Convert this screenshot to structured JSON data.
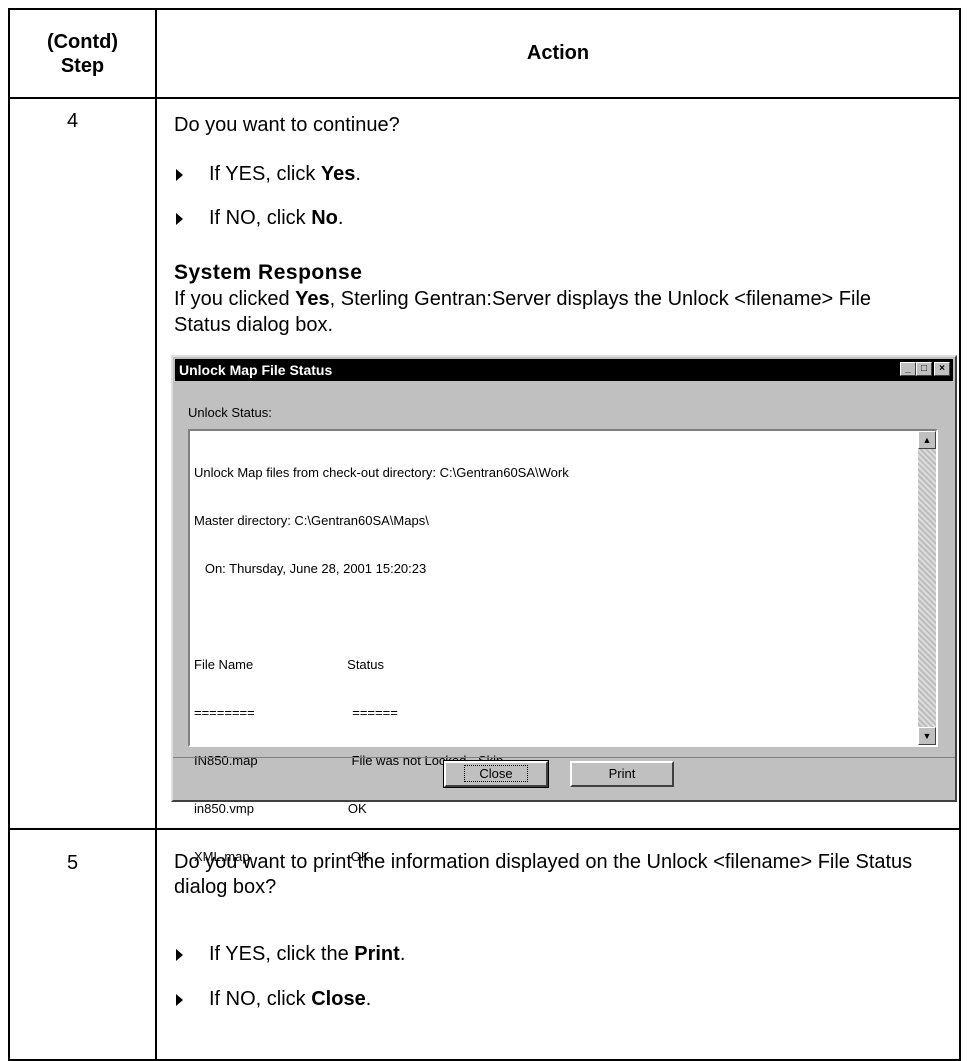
{
  "header": {
    "step_label": "(Contd)\nStep",
    "action_label": "Action"
  },
  "step4": {
    "number": "4",
    "question": "Do you want to continue?",
    "bullets": [
      {
        "prefix": "If YES, click ",
        "bold": "Yes",
        "suffix": "."
      },
      {
        "prefix": "If NO, click ",
        "bold": "No",
        "suffix": "."
      }
    ],
    "system_response_title": "System Response",
    "system_response_prefix": "If you clicked ",
    "system_response_bold": "Yes",
    "system_response_suffix": ", Sterling Gentran:Server displays the Unlock <filename> File Status dialog box."
  },
  "dialog": {
    "title": "Unlock Map File Status",
    "status_label": "Unlock Status:",
    "lines": [
      "Unlock Map files from check-out directory: C:\\Gentran60SA\\Work",
      "Master directory: C:\\Gentran60SA\\Maps\\",
      "   On: Thursday, June 28, 2001 15:20:23",
      "",
      "File Name                          Status",
      "========                           ======",
      "IN850.map                          File was not Locked - Skip",
      "in850.vmp                          OK",
      "XML.map                            OK"
    ],
    "close_button": "Close",
    "print_button": "Print"
  },
  "step5": {
    "number": "5",
    "question": "Do you want to print the information displayed on the Unlock <filename> File Status dialog box?",
    "bullets": [
      {
        "prefix": "If YES, click the ",
        "bold": "Print",
        "suffix": "."
      },
      {
        "prefix": "If NO, click ",
        "bold": "Close",
        "suffix": "."
      }
    ]
  }
}
